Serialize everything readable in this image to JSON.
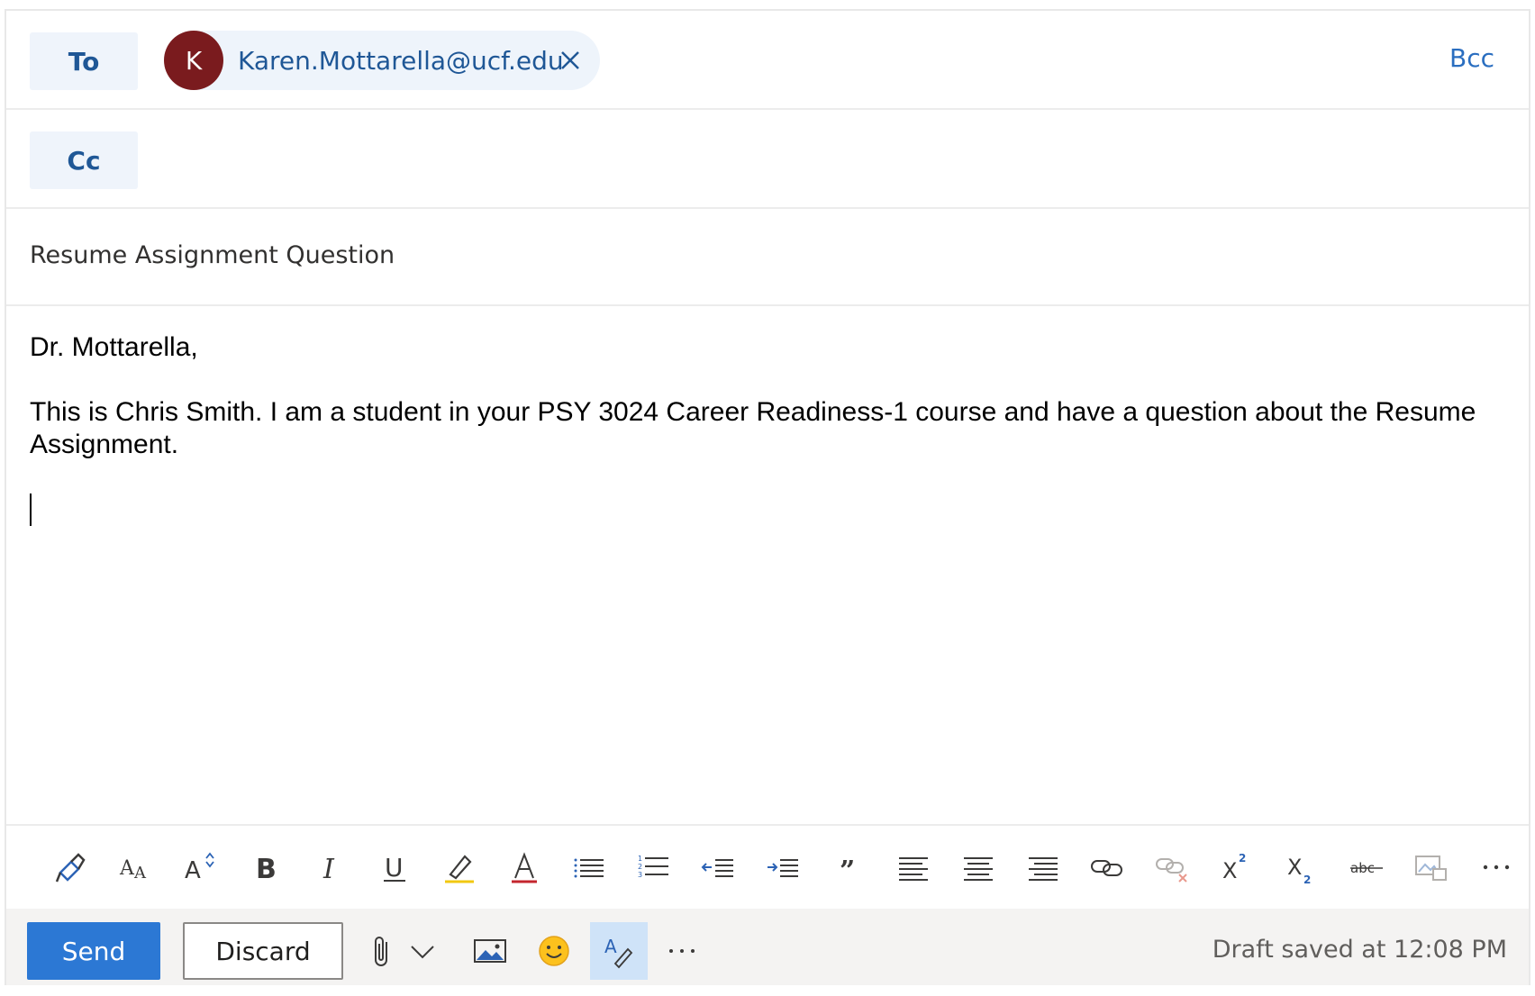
{
  "to_row": {
    "label": "To",
    "recipient": {
      "initial": "K",
      "email": "Karen.Mottarella@ucf.edu"
    },
    "bcc_label": "Bcc"
  },
  "cc_row": {
    "label": "Cc"
  },
  "subject": "Resume Assignment Question",
  "body": {
    "greeting": "Dr. Mottarella,",
    "paragraph": "This is Chris Smith. I am a student  in your PSY 3024 Career Readiness-1 course and have a question about the Resume Assignment."
  },
  "format_toolbar": {
    "icons": [
      "format-painter-icon",
      "font-icon",
      "font-size-icon",
      "bold-icon",
      "italic-icon",
      "underline-icon",
      "highlight-icon",
      "font-color-icon",
      "bullets-icon",
      "numbering-icon",
      "decrease-indent-icon",
      "increase-indent-icon",
      "quote-icon",
      "align-left-icon",
      "align-center-icon",
      "align-right-icon",
      "insert-link-icon",
      "remove-link-icon",
      "superscript-icon",
      "subscript-icon",
      "strikethrough-icon",
      "resize-image-icon",
      "more-icon"
    ]
  },
  "actions": {
    "send_label": "Send",
    "discard_label": "Discard",
    "draft_status": "Draft saved at 12:08 PM"
  },
  "colors": {
    "accent": "#2c78d4",
    "avatar": "#7a1b1e",
    "link": "#1f5796"
  }
}
